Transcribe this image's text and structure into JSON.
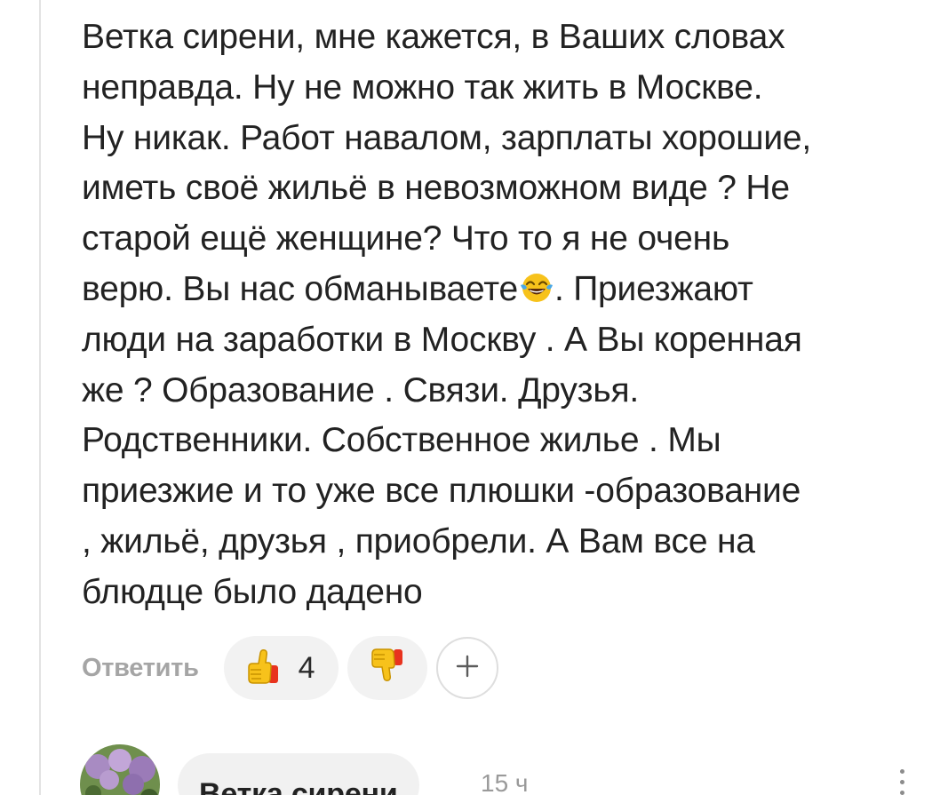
{
  "comment": {
    "lines": [
      "Ветка сирени, мне кажется, в Ваших словах",
      "неправда. Ну не можно так жить в Москве.",
      "Ну никак. Работ навалом, зарплаты хорошие,",
      "иметь своё жильё в невозможном виде ? Не",
      "старой ещё женщине? Что то я не очень",
      "верю. Вы нас обманываете",
      ". Приезжают",
      "люди на заработки в Москву . А Вы коренная",
      "же ? Образование . Связи. Друзья.",
      "Родственники. Собственное жилье . Мы",
      "приезжие и то уже все плюшки -образование",
      ", жильё, друзья , приобрели. А Вам все на",
      "блюдце было дадено"
    ],
    "emoji": "tears-of-joy-emoji"
  },
  "actions": {
    "reply_label": "Ответить",
    "like_count": "4",
    "like_icon": "thumbs-up-icon",
    "dislike_icon": "thumbs-down-icon",
    "add_reaction_icon": "plus-icon"
  },
  "reply": {
    "author": "Ветка сирени",
    "time": "15 ч",
    "avatar": "lilac-photo-avatar",
    "menu_icon": "more-vertical-icon"
  },
  "colors": {
    "text": "#222222",
    "muted": "#a5a5a5",
    "pill_bg": "#f2f2f2",
    "emoji_yellow": "#f7c21b",
    "dislike_red": "#e8331e"
  }
}
